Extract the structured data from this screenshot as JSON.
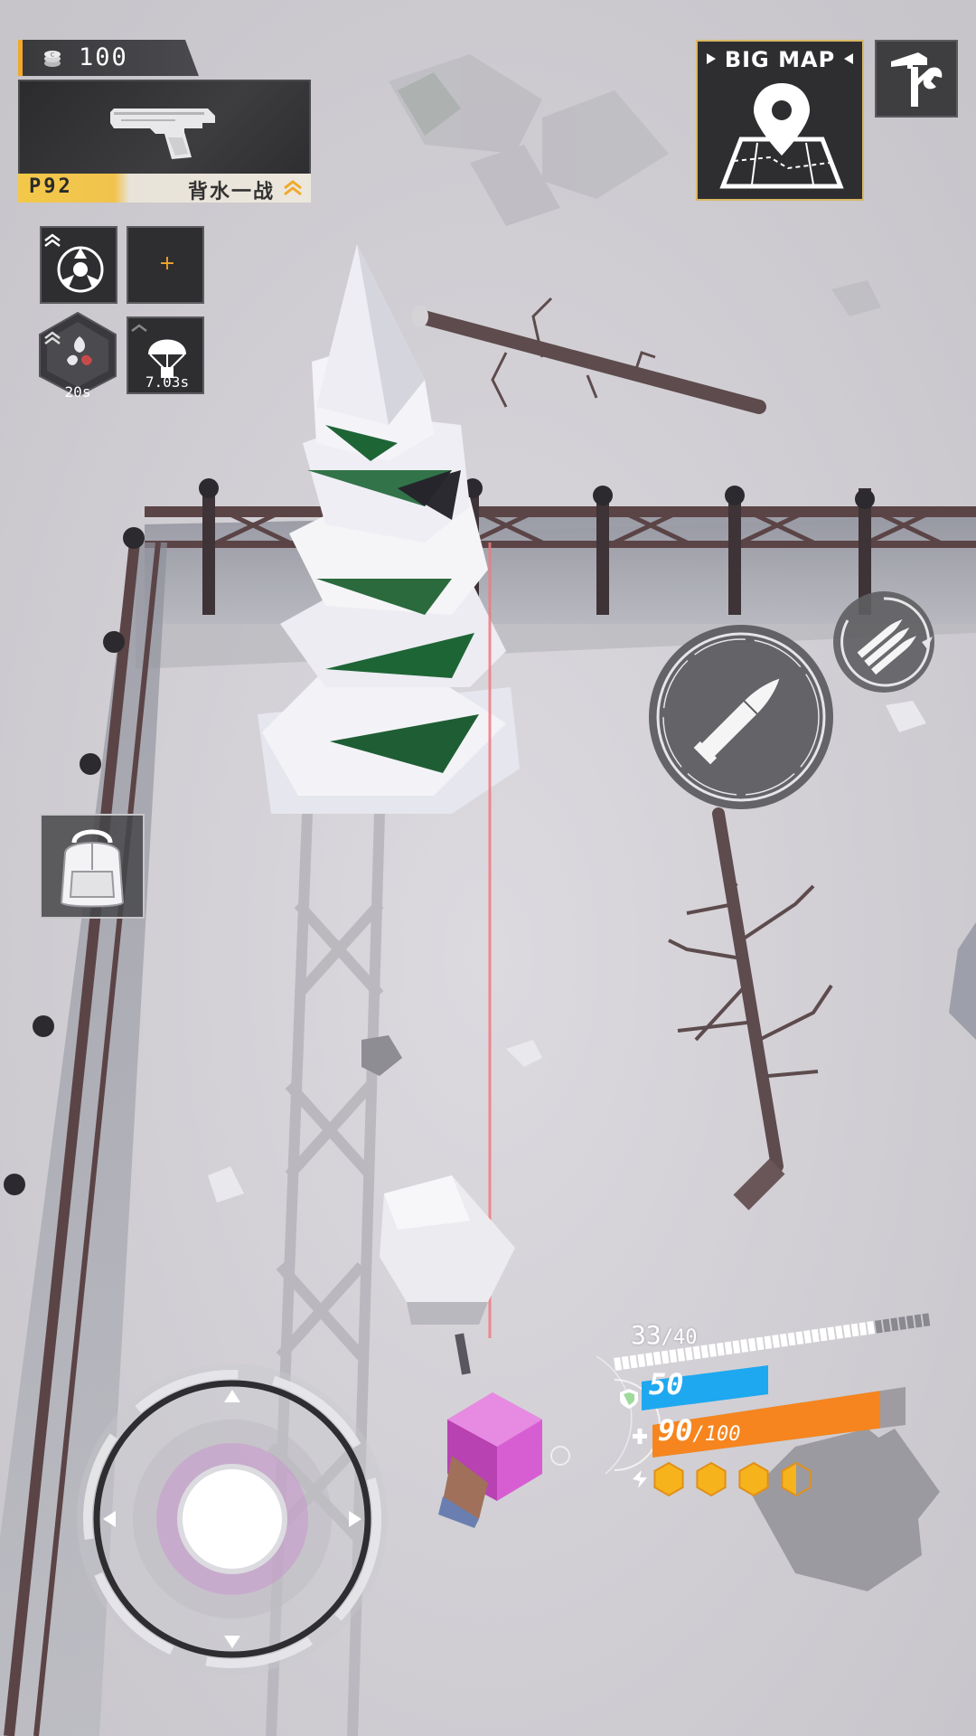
{
  "hud": {
    "coins": "100",
    "weapon": {
      "name": "P92",
      "skill_label": "背水一战",
      "icon": "pistol-icon"
    },
    "skills": [
      {
        "icon": "radiation-drone-icon",
        "cooldown": ""
      },
      {
        "icon": "add-slot-icon",
        "label": "+"
      },
      {
        "icon": "airdrop-parachute-icon",
        "cooldown": "7.03s"
      },
      {
        "icon": "toxic-hex-icon",
        "cooldown": "20s"
      }
    ],
    "big_map_label": "BIG MAP",
    "tools_icon": "hammer-wrench-icon",
    "backpack_icon": "backpack-icon",
    "fire_icon": "bullet-icon",
    "reload_icon": "triple-bullets-reload-icon"
  },
  "status": {
    "ammo_current": "33",
    "ammo_separator": "/",
    "ammo_max": "40",
    "ammo_fraction": 0.825,
    "shield": "50",
    "hp_current": "90",
    "hp_separator": "/",
    "hp_max": "100",
    "hp_fraction": 0.9,
    "energy_cells_full": 3,
    "energy_cells_total": 4
  },
  "colors": {
    "accent": "#f0a92b",
    "shield": "#1ea8f0",
    "hp": "#f6851f",
    "energy": "#f6b31b",
    "panel": "#2e2e31",
    "snow": "#d8d6db"
  }
}
